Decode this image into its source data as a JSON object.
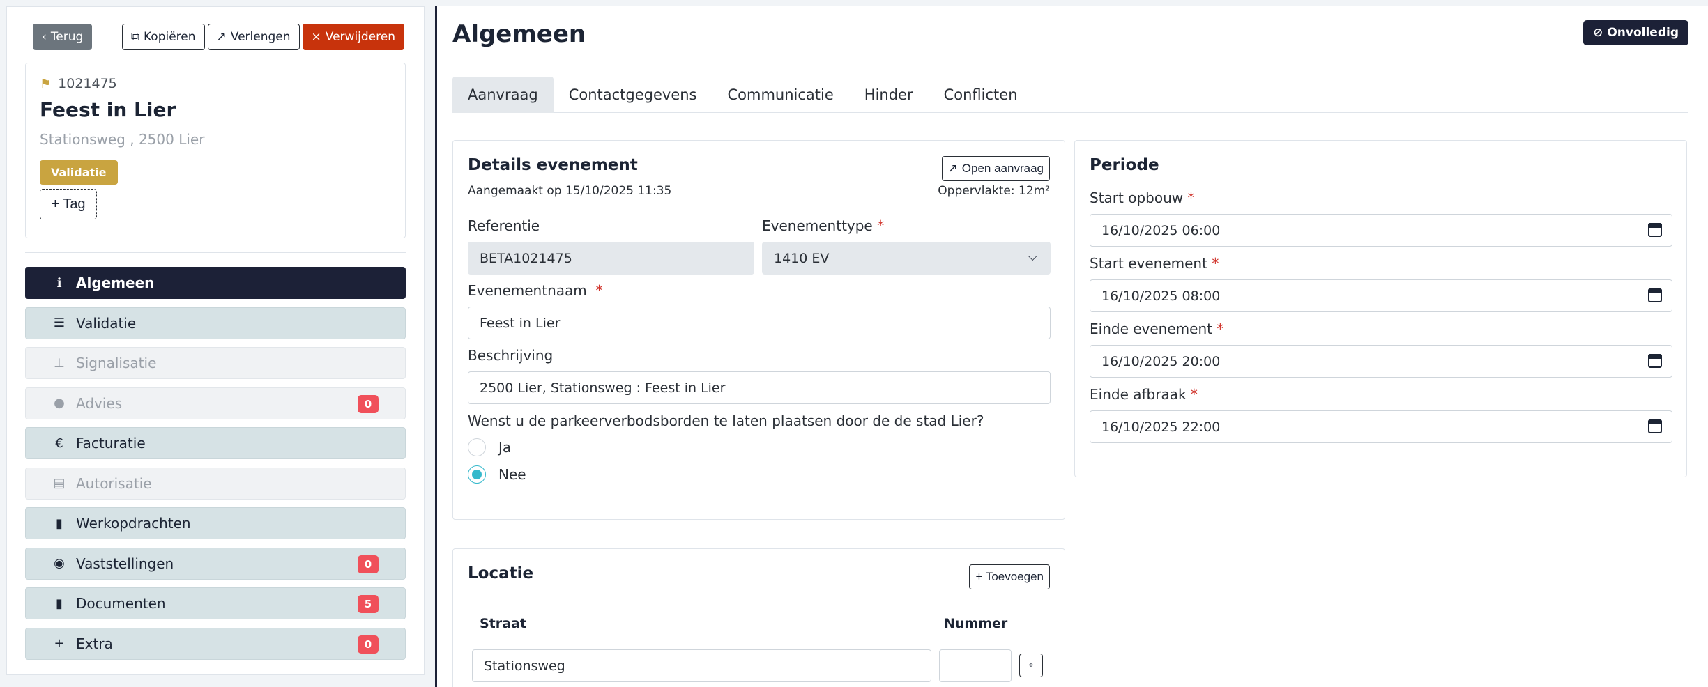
{
  "header": {
    "back_label": "Terug",
    "copy_label": "Kopiëren",
    "extend_label": "Verlengen",
    "delete_label": "Verwijderen"
  },
  "summary": {
    "id": "1021475",
    "title": "Feest in Lier",
    "address": "Stationsweg , 2500 Lier",
    "status_badge": "Validatie",
    "add_tag_label": "+ Tag"
  },
  "nav": [
    {
      "label": "Algemeen",
      "icon": "info-circle-icon",
      "glyph": "ℹ",
      "state": "active"
    },
    {
      "label": "Validatie",
      "icon": "checklist-icon",
      "glyph": "☰",
      "state": "normal"
    },
    {
      "label": "Signalisatie",
      "icon": "signpost-icon",
      "glyph": "⊥",
      "state": "disabled"
    },
    {
      "label": "Advies",
      "icon": "chat-icon",
      "glyph": "●",
      "state": "disabled",
      "count": "0"
    },
    {
      "label": "Facturatie",
      "icon": "euro-icon",
      "glyph": "€",
      "state": "normal"
    },
    {
      "label": "Autorisatie",
      "icon": "file-lock-icon",
      "glyph": "▤",
      "state": "disabled"
    },
    {
      "label": "Werkopdrachten",
      "icon": "file-icon",
      "glyph": "▮",
      "state": "normal"
    },
    {
      "label": "Vaststellingen",
      "icon": "eye-icon",
      "glyph": "◉",
      "state": "normal",
      "count": "0"
    },
    {
      "label": "Documenten",
      "icon": "document-icon",
      "glyph": "▮",
      "state": "normal",
      "count": "5"
    },
    {
      "label": "Extra",
      "icon": "plus-icon",
      "glyph": "+",
      "state": "normal",
      "count": "0"
    }
  ],
  "main": {
    "title": "Algemeen",
    "status_label": "Onvolledig",
    "tabs": [
      "Aanvraag",
      "Contactgegevens",
      "Communicatie",
      "Hinder",
      "Conflicten"
    ]
  },
  "details": {
    "title": "Details evenement",
    "open_button": "Open aanvraag",
    "created": "Aangemaakt op 15/10/2025 11:35",
    "area": "Oppervlakte: 12m²",
    "referentie_label": "Referentie",
    "referentie_value": "BETA1021475",
    "type_label": "Evenementtype",
    "type_value": "1410 EV",
    "name_label": "Evenementnaam",
    "name_value": "Feest in Lier",
    "desc_label": "Beschrijving",
    "desc_value": "2500 Lier, Stationsweg : Feest in Lier",
    "question": "Wenst u de parkeerverbodsborden te laten plaatsen door de de stad Lier?",
    "option_yes": "Ja",
    "option_no": "Nee",
    "selected": "Nee"
  },
  "periode": {
    "title": "Periode",
    "start_opbouw_label": "Start opbouw",
    "start_opbouw_value": "16/10/2025 06:00",
    "start_evenement_label": "Start evenement",
    "start_evenement_value": "16/10/2025 08:00",
    "einde_evenement_label": "Einde evenement",
    "einde_evenement_value": "16/10/2025 20:00",
    "einde_afbraak_label": "Einde afbraak",
    "einde_afbraak_value": "16/10/2025 22:00"
  },
  "locatie": {
    "title": "Locatie",
    "add_button": "+ Toevoegen",
    "col_street": "Straat",
    "col_number": "Nummer",
    "street_value": "Stationsweg",
    "number_value": ""
  },
  "colors": {
    "navy": "#1c2137",
    "danger": "#c8330c",
    "badge_gold": "#c9a440",
    "count_red": "#f0505a",
    "radio_teal": "#36b9cc"
  }
}
